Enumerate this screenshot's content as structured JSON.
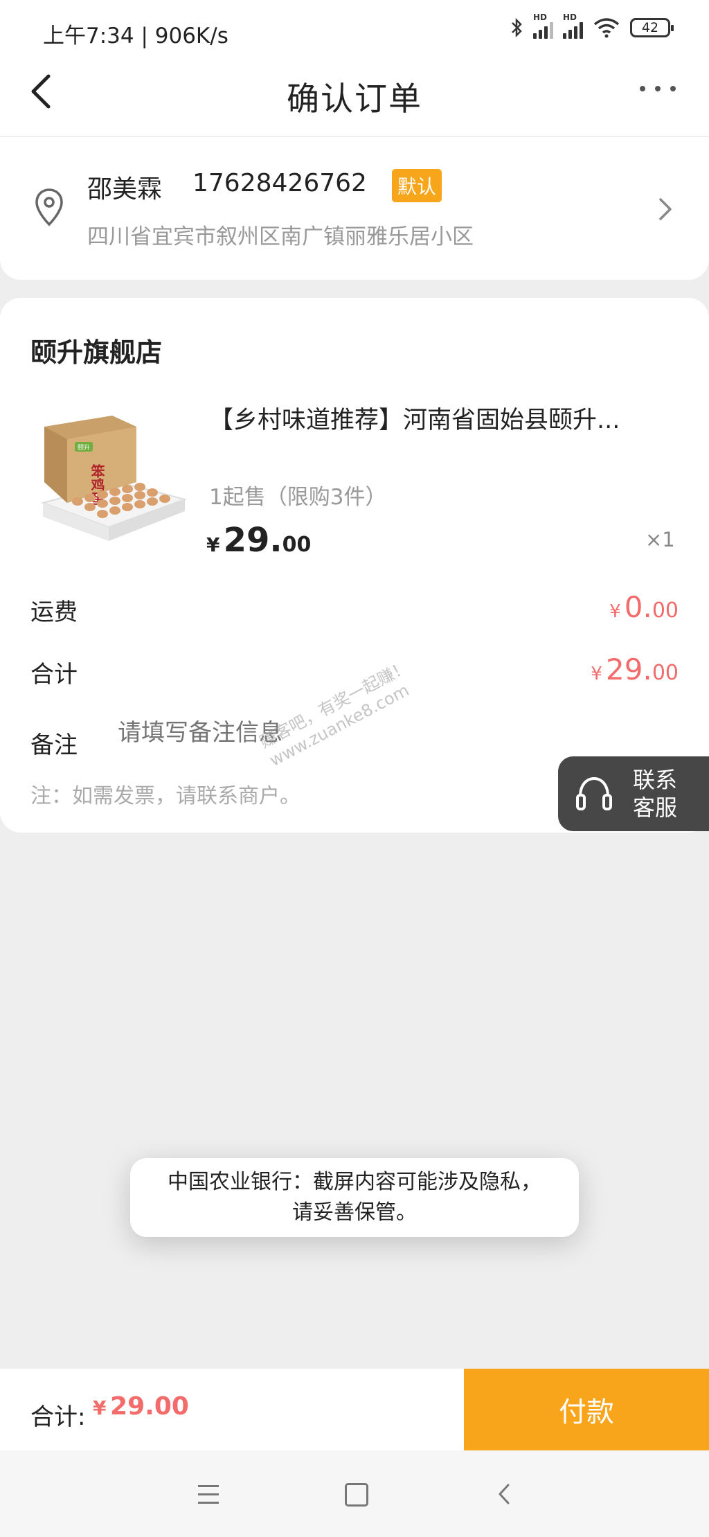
{
  "status_bar": {
    "time": "上午7:34 | 906K/s",
    "battery": "42",
    "signal_label": "HD"
  },
  "header": {
    "title": "确认订单"
  },
  "address": {
    "name": "邵美霖",
    "phone": "17628426762",
    "default_tag": "默认",
    "detail": "四川省宜宾市叙州区南广镇丽雅乐居小区"
  },
  "store": {
    "name": "颐升旗舰店"
  },
  "product": {
    "title": "【乡村味道推荐】河南省固始县颐升...",
    "limit_text": "1起售（限购3件）",
    "price_currency": "¥",
    "price_int": "29.",
    "price_dec": "00",
    "quantity": "×1",
    "image_label": "笨鸡蛋",
    "image_brand": "颐升"
  },
  "summary": {
    "shipping_label": "运费",
    "shipping_currency": "¥",
    "shipping_int": "0.",
    "shipping_dec": "00",
    "subtotal_label": "合计",
    "subtotal_currency": "¥",
    "subtotal_int": "29.",
    "subtotal_dec": "00",
    "remark_label": "备注",
    "remark_placeholder": "请填写备注信息",
    "invoice_note": "注：如需发票，请联系商户。"
  },
  "customer_service": {
    "line1": "联系",
    "line2": "客服"
  },
  "watermark": {
    "line1": "赚客吧，有奖一起赚！",
    "line2": "www.zuanke8.com"
  },
  "toast": {
    "line1": "中国农业银行：截屏内容可能涉及隐私，",
    "line2": "请妥善保管。"
  },
  "footer": {
    "total_label": "合计:",
    "total_currency": "¥",
    "total_value": "29.00",
    "pay_button": "付款"
  },
  "colors": {
    "accent": "#f9a51b",
    "price_red": "#f36b6b",
    "tag_orange": "#f7a61c"
  },
  "icons": {
    "back": "chevron-left-icon",
    "more": "more-dots-icon",
    "location": "location-pin-icon",
    "chevron": "chevron-right-icon",
    "headset": "headset-icon"
  }
}
